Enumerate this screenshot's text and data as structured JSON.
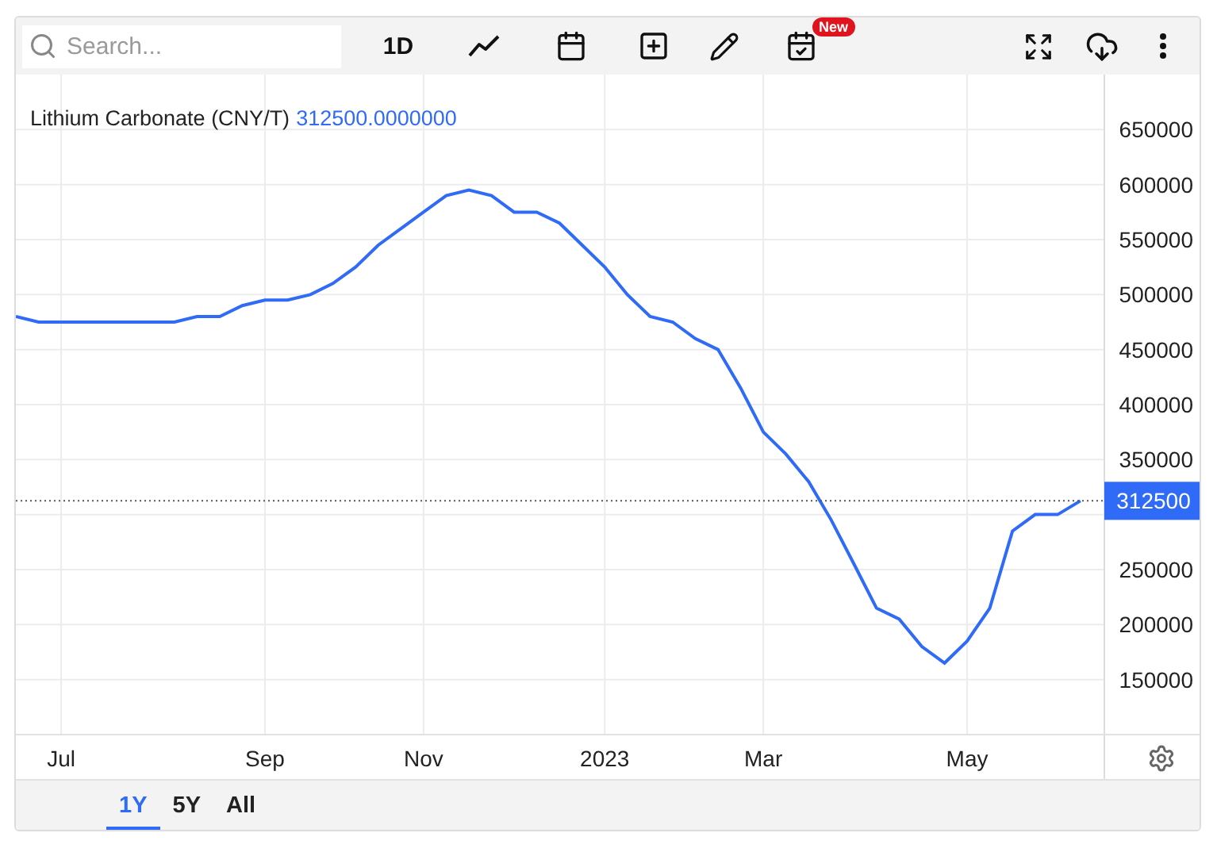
{
  "toolbar": {
    "search": {
      "placeholder": "Search..."
    },
    "interval": "1D",
    "new_badge": "New"
  },
  "chart": {
    "title": "Lithium Carbonate (CNY/T)",
    "last_value": "312500.0000000",
    "price_badge": "312500",
    "chart_data": {
      "type": "line",
      "grid": true,
      "ref_lines": [
        {
          "axis": "y",
          "value": 312500
        }
      ],
      "ylim": [
        100000,
        700000
      ],
      "yticks": [
        150000,
        200000,
        250000,
        350000,
        400000,
        450000,
        500000,
        550000,
        600000,
        650000
      ],
      "categories": [
        null,
        null,
        "Jul",
        null,
        null,
        null,
        null,
        null,
        null,
        null,
        null,
        "Sep",
        null,
        null,
        null,
        null,
        null,
        null,
        "Nov",
        null,
        null,
        null,
        null,
        null,
        null,
        null,
        "2023",
        null,
        null,
        null,
        null,
        null,
        null,
        "Mar",
        null,
        null,
        null,
        null,
        null,
        null,
        null,
        null,
        "May",
        null,
        null,
        null,
        null,
        null
      ],
      "series": [
        {
          "color": "#2f6bf6",
          "values": [
            480000,
            475000,
            475000,
            475000,
            475000,
            475000,
            475000,
            475000,
            480000,
            480000,
            490000,
            495000,
            495000,
            500000,
            510000,
            525000,
            545000,
            560000,
            575000,
            590000,
            595000,
            590000,
            575000,
            575000,
            565000,
            545000,
            525000,
            500000,
            480000,
            475000,
            460000,
            450000,
            415000,
            375000,
            355000,
            330000,
            295000,
            255000,
            215000,
            205000,
            180000,
            165000,
            185000,
            215000,
            285000,
            300000,
            300000,
            312500
          ]
        }
      ]
    }
  },
  "ranges": [
    {
      "label": "1Y",
      "selected": true
    },
    {
      "label": "5Y",
      "selected": false
    },
    {
      "label": "All",
      "selected": false
    }
  ]
}
